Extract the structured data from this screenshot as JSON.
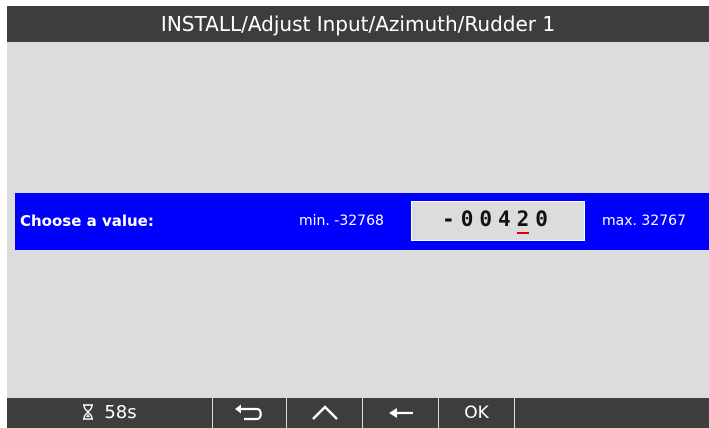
{
  "screen": {
    "title": "INSTALL/Adjust Input/Azimuth/Rudder 1",
    "prompt_label": "Choose a value:",
    "min_label": "min. -32768",
    "max_label": "max. 32767",
    "value_sign": "-",
    "value_digits_before_cursor": "004",
    "value_cursor_digit": "2",
    "value_digits_after_cursor": "0",
    "cursor_color": "#e00000",
    "accent_color": "#0000ff"
  },
  "softkeys": {
    "timer_icon": "hourglass-icon",
    "timer_label": "58s",
    "back_icon": "return-arrow-icon",
    "up_icon": "caret-up-icon",
    "left_icon": "left-arrow-icon",
    "ok_label": "OK"
  }
}
